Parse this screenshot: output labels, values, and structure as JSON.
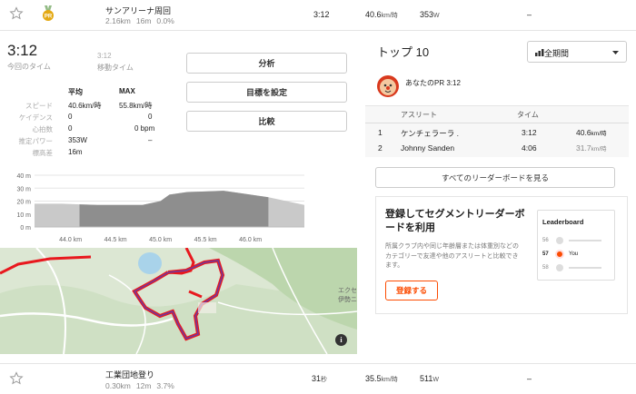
{
  "top_segment": {
    "name": "サンアリーナ周回",
    "distance": "2.16km",
    "elevation": "16m",
    "grade": "0.0%",
    "time": "3:12",
    "speed_value": "40.6",
    "speed_unit": "km/時",
    "power_value": "353",
    "power_unit": "W",
    "dash": "–"
  },
  "summary": {
    "time": "3:12",
    "time_label": "今回のタイム",
    "moving_time": "3:12",
    "moving_label": "移動タイム"
  },
  "stats": {
    "col_avg": "平均",
    "col_max": "MAX",
    "rows": [
      {
        "label": "スピード",
        "avg": "40.6km/時",
        "max": "55.8km/時"
      },
      {
        "label": "ケイデンス",
        "avg": "0",
        "max": "0"
      },
      {
        "label": "心拍数",
        "avg": "0",
        "max": "0 bpm"
      },
      {
        "label": "推定パワー",
        "avg": "353W",
        "max": "–"
      },
      {
        "label": "標高差",
        "avg": "16m",
        "max": ""
      }
    ]
  },
  "buttons": {
    "analyze": "分析",
    "set_goal": "目標を設定",
    "compare": "比較"
  },
  "chart_data": {
    "type": "area",
    "x": [
      43.6,
      43.9,
      44.1,
      44.3,
      44.5,
      44.8,
      45.0,
      45.1,
      45.3,
      45.5,
      45.7,
      45.8,
      46.0,
      46.2,
      46.4,
      46.6
    ],
    "values": [
      18,
      18,
      17.5,
      17,
      17,
      17,
      20,
      25,
      27,
      27.5,
      28,
      27,
      25,
      23,
      20,
      17
    ],
    "highlight_range": [
      44.1,
      46.2
    ],
    "ylim": [
      0,
      40
    ],
    "yticks": [
      "40 m",
      "30 m",
      "20 m",
      "10 m",
      "0 m"
    ],
    "xticks": [
      "44.0 km",
      "44.5 km",
      "45.0 km",
      "45.5 km",
      "46.0 km"
    ]
  },
  "map": {
    "info": "i",
    "label1": "エクセ",
    "label2": "伊勢ニ"
  },
  "leaderboard": {
    "title": "トップ 10",
    "filter": "全期間",
    "pr_label": "あなたのPR 3:12",
    "col_athlete": "アスリート",
    "col_time": "タイム",
    "rows": [
      {
        "rank": "1",
        "name": "ケンチェラーラ .",
        "time": "3:12",
        "speed_value": "40.6",
        "speed_unit": "km/時"
      },
      {
        "rank": "2",
        "name": "Johnny Sanden",
        "time": "4:06",
        "speed_value": "31.7",
        "speed_unit": "km/時"
      }
    ],
    "see_all": "すべてのリーダーボードを見る"
  },
  "promo": {
    "title": "登録してセグメントリーダーボードを利用",
    "text": "所属クラブ内や同じ年齢層または体重別などのカテゴリーで友達や他のアスリートと比較できます。",
    "button": "登録する",
    "card_title": "Leaderboard",
    "r1": "56",
    "r2": "57",
    "r2_name": "You",
    "r3": "58"
  },
  "bottom_segment": {
    "name": "工業団地登り",
    "distance": "0.30km",
    "elevation": "12m",
    "grade": "3.7%",
    "time_value": "31",
    "time_unit": "秒",
    "speed_value": "35.5",
    "speed_unit": "km/時",
    "power_value": "511",
    "power_unit": "W",
    "dash": "–"
  },
  "colors": {
    "accent": "#fc4c02",
    "route": "#e8181e",
    "route_segment": "#6b3aa0",
    "gold": "#e4a913"
  }
}
